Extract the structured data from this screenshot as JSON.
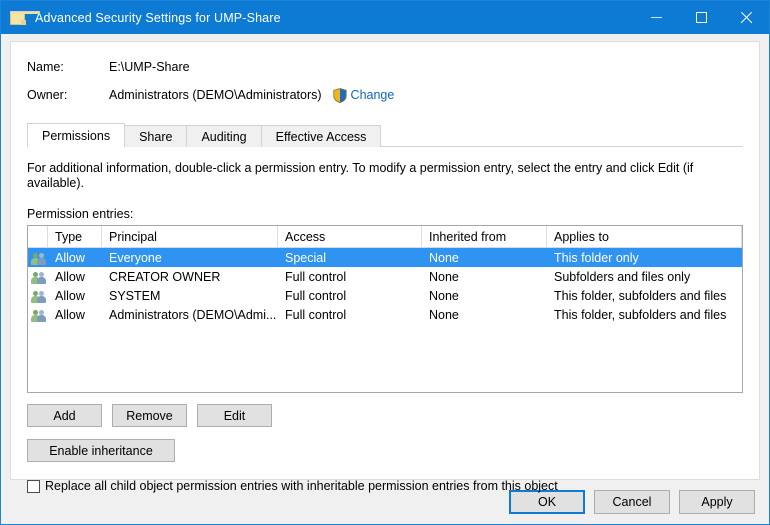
{
  "window": {
    "title": "Advanced Security Settings for UMP-Share",
    "folder_icon": "folder-icon",
    "controls": {
      "minimize": "minimize-icon",
      "maximize": "maximize-icon",
      "close": "close-icon"
    }
  },
  "colors": {
    "titlebar": "#0d7bd4",
    "selection": "#2f93f2",
    "link": "#1366b8",
    "dialog_bg": "#f0f0f0",
    "accent_border": "#1b84d8"
  },
  "header": {
    "name_label": "Name:",
    "name_value": "E:\\UMP-Share",
    "owner_label": "Owner:",
    "owner_value": "Administrators (DEMO\\Administrators)",
    "shield_icon": "uac-shield-icon",
    "change_link": "Change"
  },
  "tabs": [
    {
      "label": "Permissions",
      "active": true
    },
    {
      "label": "Share",
      "active": false
    },
    {
      "label": "Auditing",
      "active": false
    },
    {
      "label": "Effective Access",
      "active": false
    }
  ],
  "main": {
    "hint": "For additional information, double-click a permission entry. To modify a permission entry, select the entry and click Edit (if available).",
    "entries_label": "Permission entries:",
    "columns": [
      "Type",
      "Principal",
      "Access",
      "Inherited from",
      "Applies to"
    ],
    "rows": [
      {
        "icon": "group-icon",
        "type": "Allow",
        "principal": "Everyone",
        "access": "Special",
        "inherited_from": "None",
        "applies_to": "This folder only",
        "selected": true
      },
      {
        "icon": "group-icon",
        "type": "Allow",
        "principal": "CREATOR OWNER",
        "access": "Full control",
        "inherited_from": "None",
        "applies_to": "Subfolders and files only",
        "selected": false
      },
      {
        "icon": "group-icon",
        "type": "Allow",
        "principal": "SYSTEM",
        "access": "Full control",
        "inherited_from": "None",
        "applies_to": "This folder, subfolders and files",
        "selected": false
      },
      {
        "icon": "group-icon",
        "type": "Allow",
        "principal": "Administrators (DEMO\\Admi...",
        "access": "Full control",
        "inherited_from": "None",
        "applies_to": "This folder, subfolders and files",
        "selected": false
      }
    ],
    "buttons": {
      "add": "Add",
      "remove": "Remove",
      "edit": "Edit",
      "enable_inheritance": "Enable inheritance"
    },
    "replace_checkbox": {
      "label": "Replace all child object permission entries with inheritable permission entries from this object",
      "checked": false
    }
  },
  "footer": {
    "ok": "OK",
    "cancel": "Cancel",
    "apply": "Apply"
  }
}
